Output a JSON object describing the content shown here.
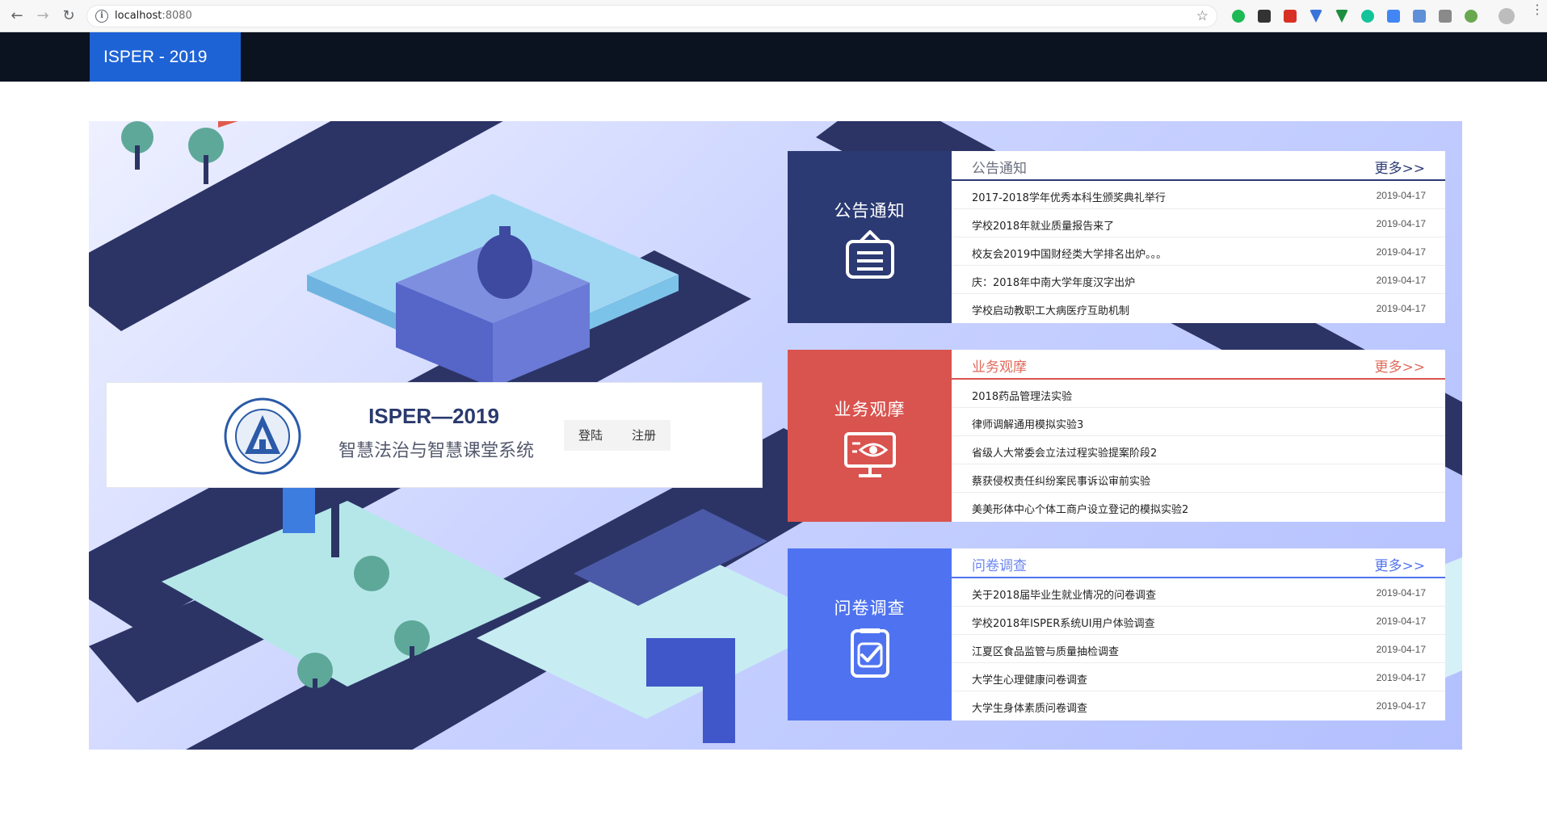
{
  "browser": {
    "url_host": "localhost",
    "url_port": ":8080"
  },
  "header": {
    "brand": "ISPER - 2019"
  },
  "login": {
    "title": "ISPER—2019",
    "subtitle": "智慧法治与智慧课堂系统",
    "login_label": "登陆",
    "register_label": "注册"
  },
  "panels": [
    {
      "side_title": "公告通知",
      "list_title": "公告通知",
      "more_label": "更多>>",
      "accent": "#2b3a73",
      "icon": "clipboard-icon",
      "items": [
        {
          "title": "2017-2018学年优秀本科生颁奖典礼举行",
          "date": "2019-04-17"
        },
        {
          "title": "学校2018年就业质量报告来了",
          "date": "2019-04-17"
        },
        {
          "title": "校友会2019中国财经类大学排名出炉。。。",
          "date": "2019-04-17"
        },
        {
          "title": "庆：2018年中南大学年度汉字出炉",
          "date": "2019-04-17"
        },
        {
          "title": "学校启动教职工大病医疗互助机制",
          "date": "2019-04-17"
        }
      ]
    },
    {
      "side_title": "业务观摩",
      "list_title": "业务观摩",
      "more_label": "更多>>",
      "accent": "#d9534f",
      "icon": "monitor-eye-icon",
      "items": [
        {
          "title": "2018药品管理法实验",
          "date": ""
        },
        {
          "title": "律师调解通用模拟实验3",
          "date": ""
        },
        {
          "title": "省级人大常委会立法过程实验提案阶段2",
          "date": ""
        },
        {
          "title": "蔡获侵权责任纠纷案民事诉讼审前实验",
          "date": ""
        },
        {
          "title": "美美形体中心个体工商户设立登记的模拟实验2",
          "date": ""
        }
      ]
    },
    {
      "side_title": "问卷调查",
      "list_title": "问卷调查",
      "more_label": "更多>>",
      "accent": "#4f73f0",
      "icon": "checked-form-icon",
      "items": [
        {
          "title": "关于2018届毕业生就业情况的问卷调查",
          "date": "2019-04-17"
        },
        {
          "title": "学校2018年ISPER系统UI用户体验调查",
          "date": "2019-04-17"
        },
        {
          "title": "江夏区食品监管与质量抽检调查",
          "date": "2019-04-17"
        },
        {
          "title": "大学生心理健康问卷调查",
          "date": "2019-04-17"
        },
        {
          "title": "大学生身体素质问卷调查",
          "date": "2019-04-17"
        }
      ]
    }
  ]
}
